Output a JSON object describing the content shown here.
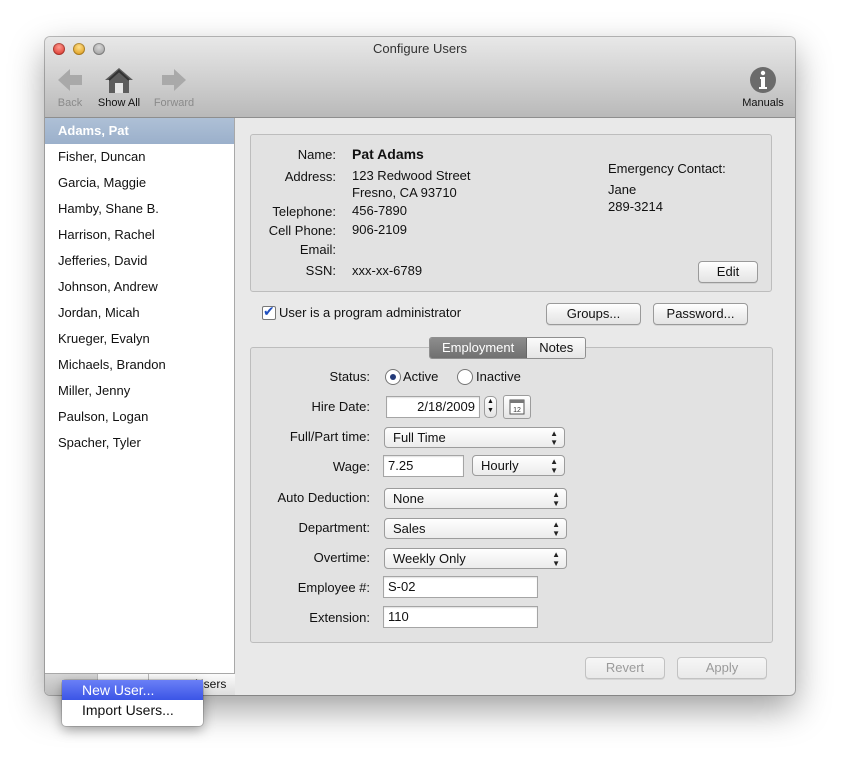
{
  "window": {
    "title": "Configure Users"
  },
  "toolbar": {
    "back_label": "Back",
    "show_all_label": "Show All",
    "forward_label": "Forward",
    "manuals_label": "Manuals"
  },
  "sidebar": {
    "items": [
      {
        "label": "Adams, Pat",
        "selected": true
      },
      {
        "label": "Fisher, Duncan"
      },
      {
        "label": "Garcia, Maggie"
      },
      {
        "label": "Hamby, Shane B."
      },
      {
        "label": "Harrison, Rachel"
      },
      {
        "label": "Jefferies, David"
      },
      {
        "label": "Johnson, Andrew"
      },
      {
        "label": "Jordan, Micah"
      },
      {
        "label": "Krueger, Evalyn"
      },
      {
        "label": "Michaels, Brandon"
      },
      {
        "label": "Miller, Jenny"
      },
      {
        "label": "Paulson, Logan"
      },
      {
        "label": "Spacher, Tyler"
      }
    ],
    "bottom_bar_label": "Users"
  },
  "contact": {
    "name_label": "Name:",
    "name": "Pat Adams",
    "address_label": "Address:",
    "address_line1": "123 Redwood Street",
    "address_line2": "Fresno, CA 93710",
    "telephone_label": "Telephone:",
    "telephone": "456-7890",
    "cell_label": "Cell Phone:",
    "cell": "906-2109",
    "email_label": "Email:",
    "email": "",
    "ssn_label": "SSN:",
    "ssn": "xxx-xx-6789",
    "emergency_label": "Emergency Contact:",
    "emergency_name": "Jane",
    "emergency_phone": "289-3214",
    "edit_label": "Edit"
  },
  "admin": {
    "checkbox_label": "User is a program administrator",
    "checked": true,
    "groups_label": "Groups...",
    "password_label": "Password..."
  },
  "tabs": [
    {
      "label": "Employment",
      "active": true
    },
    {
      "label": "Notes"
    }
  ],
  "employment": {
    "status_label": "Status:",
    "status_active_label": "Active",
    "status_inactive_label": "Inactive",
    "status_selected": "Active",
    "hire_date_label": "Hire Date:",
    "hire_date": "2/18/2009",
    "calendar_day": "12",
    "full_part_label": "Full/Part time:",
    "full_part_value": "Full Time",
    "wage_label": "Wage:",
    "wage_value": "7.25",
    "wage_unit": "Hourly",
    "auto_deduction_label": "Auto Deduction:",
    "auto_deduction_value": "None",
    "department_label": "Department:",
    "department_value": "Sales",
    "overtime_label": "Overtime:",
    "overtime_value": "Weekly Only",
    "employee_num_label": "Employee #:",
    "employee_num_value": "S-02",
    "extension_label": "Extension:",
    "extension_value": "110"
  },
  "footer": {
    "revert_label": "Revert",
    "apply_label": "Apply"
  },
  "context_menu": {
    "items": [
      {
        "label": "New User...",
        "highlighted": true
      },
      {
        "label": "Import Users..."
      }
    ]
  },
  "colors": {
    "selection": "#a9bcd3",
    "menu_highlight": "#3b55e6",
    "checkbox_blue": "#1f4fbf"
  }
}
